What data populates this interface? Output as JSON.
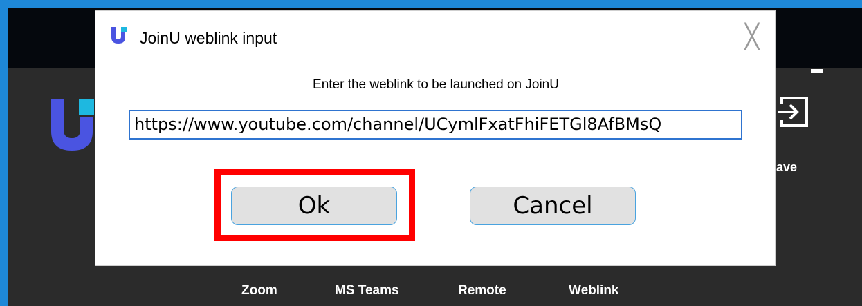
{
  "background_app": {
    "nav": [
      {
        "label": "Zoom"
      },
      {
        "label": "MS Teams"
      },
      {
        "label": "Remote"
      },
      {
        "label": "Weblink"
      }
    ],
    "leave_label": "eave",
    "minimize_label": "-"
  },
  "dialog": {
    "title": "JoinU weblink input",
    "close_glyph": "╳",
    "prompt": "Enter the weblink to be launched on JoinU",
    "weblink_value": "https://www.youtube.com/channel/UCymlFxatFhiFETGl8AfBMsQ",
    "ok_label": "Ok",
    "cancel_label": "Cancel"
  },
  "colors": {
    "window_frame": "#1e88d8",
    "titlebar": "#05080d",
    "app_body": "#2b2b2b",
    "logo_blue": "#4a54e1",
    "logo_cyan": "#1eb8e0",
    "highlight": "#ff0000",
    "input_border": "#2f74d0",
    "button_border": "#4aa3df"
  }
}
